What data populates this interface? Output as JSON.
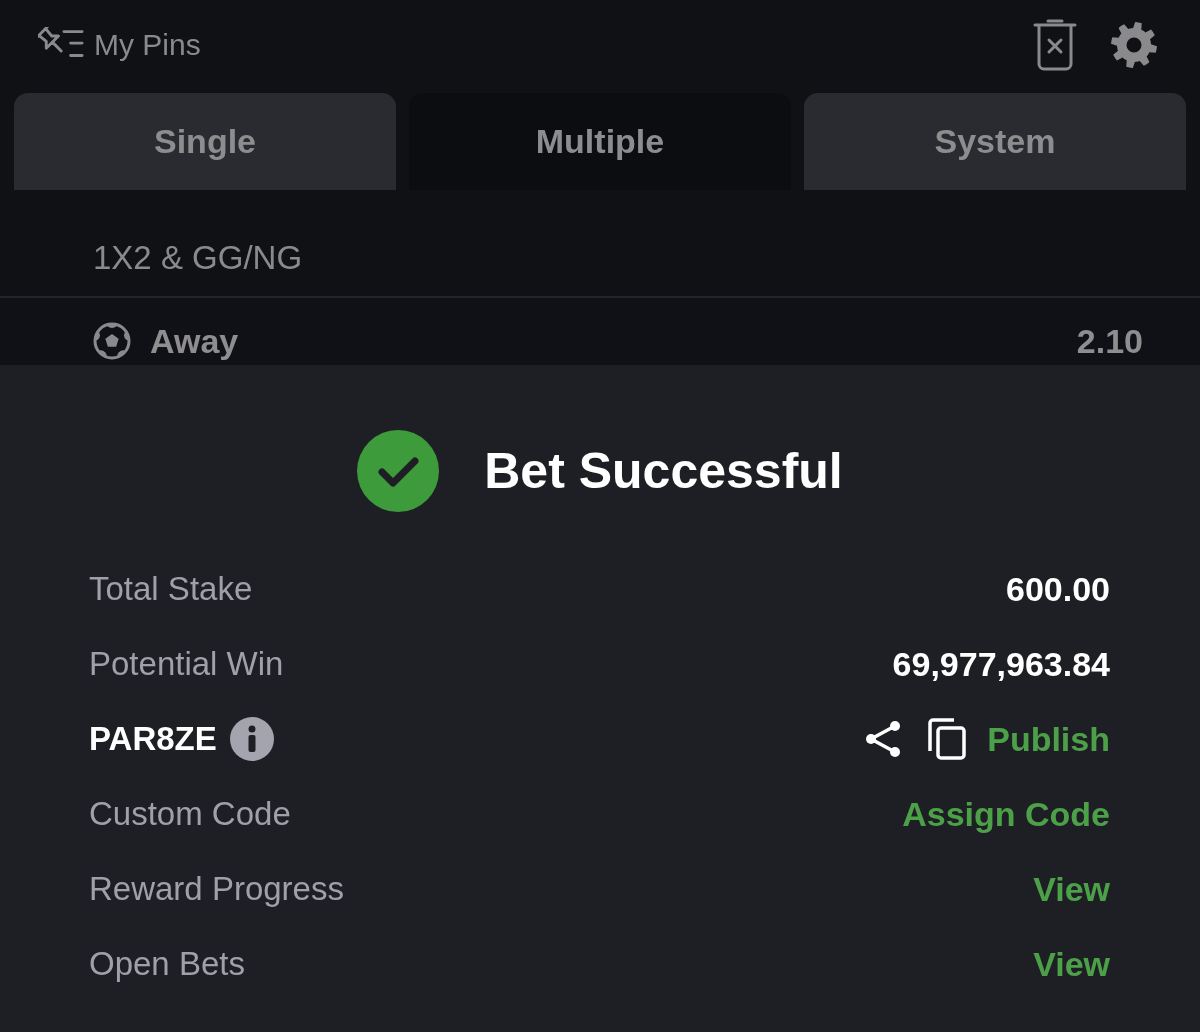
{
  "header": {
    "title": "My Pins"
  },
  "tabs": [
    {
      "label": "Single",
      "selected": false
    },
    {
      "label": "Multiple",
      "selected": true
    },
    {
      "label": "System",
      "selected": false
    }
  ],
  "selection": {
    "market": "1X2 & GG/NG",
    "pick": "Away",
    "odds": "2.10"
  },
  "confirmation": {
    "title": "Bet Successful",
    "rows": [
      {
        "kind": "value",
        "label": "Total Stake",
        "value": "600.00"
      },
      {
        "kind": "value",
        "label": "Potential Win",
        "value": "69,977,963.84"
      },
      {
        "kind": "code",
        "label": "PAR8ZE",
        "action": "Publish"
      },
      {
        "kind": "link",
        "label": "Custom Code",
        "action": "Assign Code"
      },
      {
        "kind": "link",
        "label": "Reward Progress",
        "action": "View"
      },
      {
        "kind": "link",
        "label": "Open Bets",
        "action": "View"
      }
    ]
  }
}
